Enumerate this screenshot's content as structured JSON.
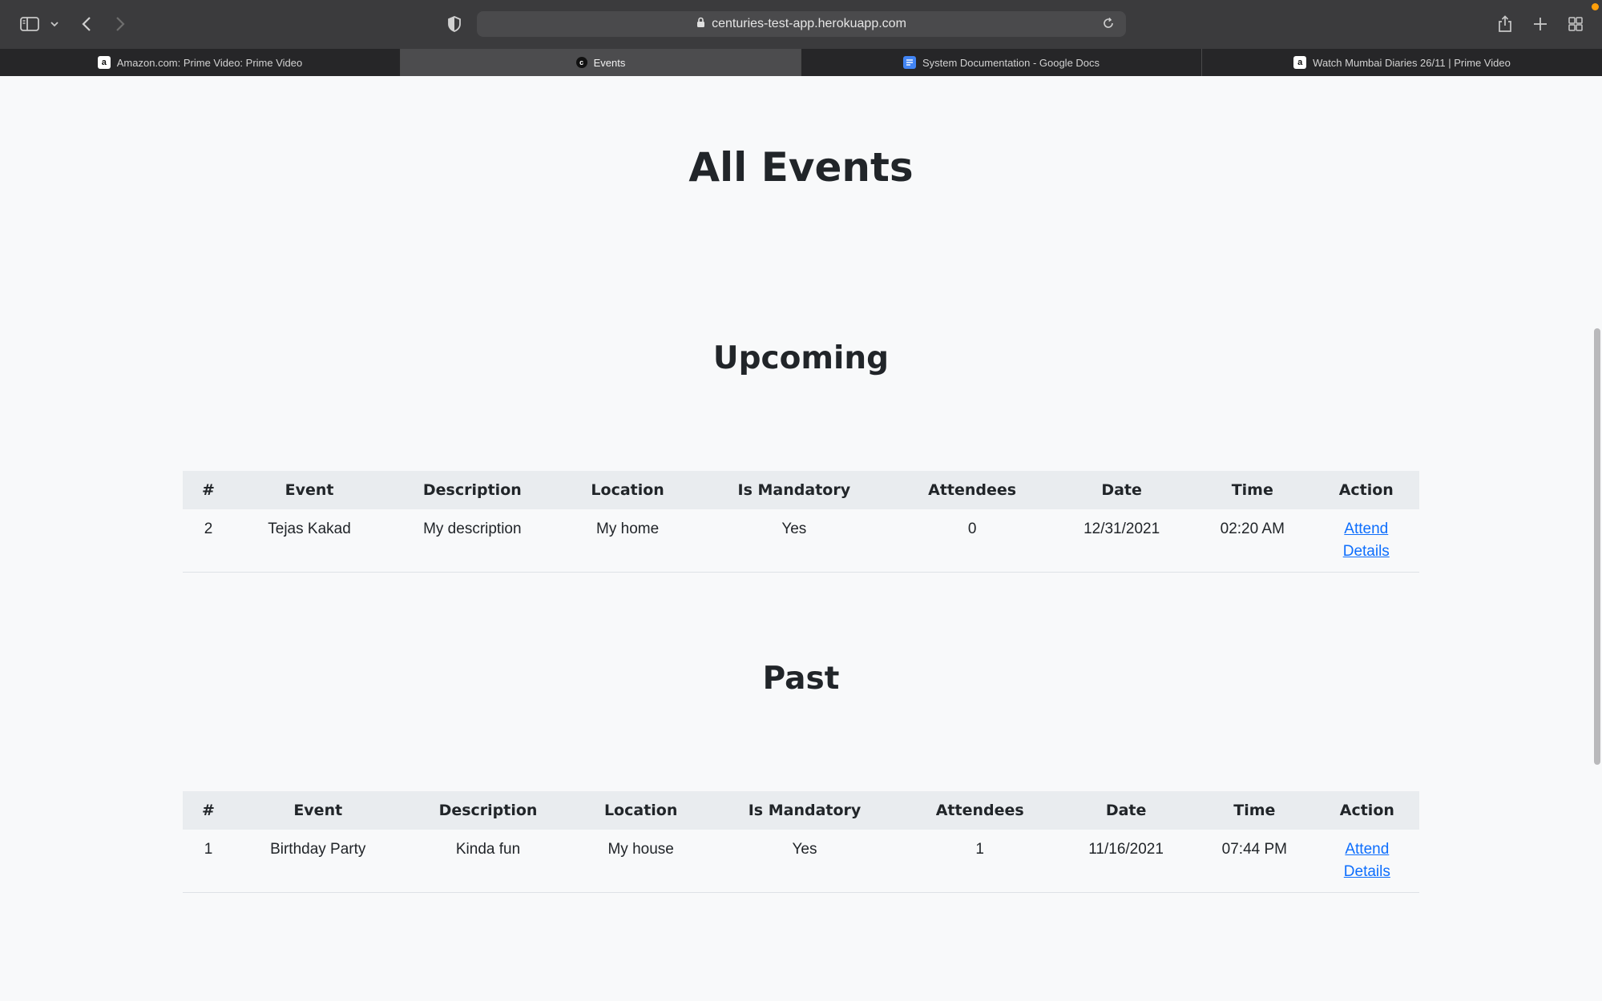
{
  "browser": {
    "url": "centuries-test-app.herokuapp.com",
    "tabs": [
      {
        "label": "Amazon.com: Prime Video: Prime Video",
        "icon": "amazon-icon"
      },
      {
        "label": "Events",
        "icon": "events-icon",
        "active": true
      },
      {
        "label": "System Documentation - Google Docs",
        "icon": "google-docs-icon"
      },
      {
        "label": "Watch Mumbai Diaries 26/11 | Prime Video",
        "icon": "amazon-icon"
      }
    ]
  },
  "page": {
    "title": "All Events",
    "upcoming": {
      "heading": "Upcoming",
      "columns": [
        "#",
        "Event",
        "Description",
        "Location",
        "Is Mandatory",
        "Attendees",
        "Date",
        "Time",
        "Action"
      ],
      "rows": [
        {
          "id": "2",
          "event": "Tejas Kakad",
          "description": "My description",
          "location": "My home",
          "mandatory": "Yes",
          "attendees": "0",
          "date": "12/31/2021",
          "time": "02:20 AM",
          "attend": "Attend",
          "details": "Details"
        }
      ]
    },
    "past": {
      "heading": "Past",
      "columns": [
        "#",
        "Event",
        "Description",
        "Location",
        "Is Mandatory",
        "Attendees",
        "Date",
        "Time",
        "Action"
      ],
      "rows": [
        {
          "id": "1",
          "event": "Birthday Party",
          "description": "Kinda fun",
          "location": "My house",
          "mandatory": "Yes",
          "attendees": "1",
          "date": "11/16/2021",
          "time": "07:44 PM",
          "attend": "Attend",
          "details": "Details"
        }
      ]
    }
  },
  "colors": {
    "link": "#0d6efd",
    "header_bg": "#e9ecef",
    "page_bg": "#f8f9fa"
  }
}
